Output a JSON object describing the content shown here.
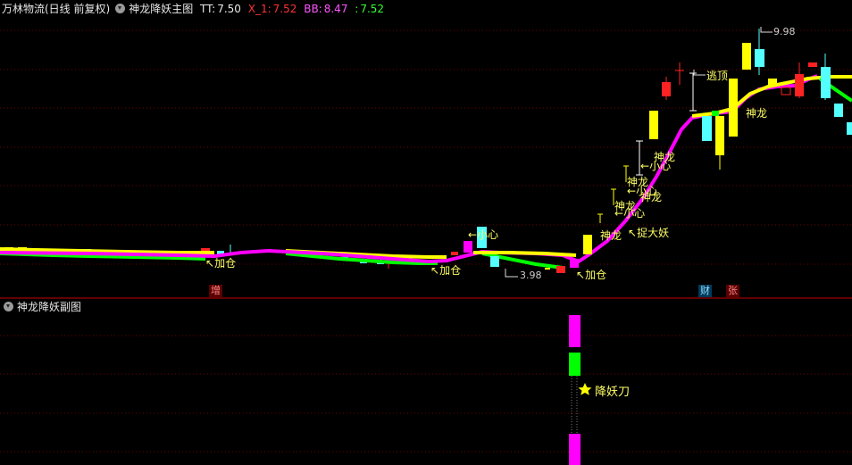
{
  "main_header": {
    "stock": "万林物流(日线 前复权)",
    "indicator": "神龙降妖主图",
    "tt_label": "TT:",
    "tt_value": "7.50",
    "x1_label": "X_1:",
    "x1_value": "7.52",
    "bb_label": "BB:",
    "bb_value": "8.47",
    "colon": ":",
    "last_value": "7.52"
  },
  "sub_header": {
    "indicator": "神龙降妖副图"
  },
  "badges": {
    "zeng": "增",
    "cai": "财",
    "zhang": "张"
  },
  "annotations": {
    "jiacang": "加仓",
    "xiaoxin": "小心",
    "shenlong": "神龙",
    "zhuodayao": "捉大妖",
    "taoding": "逃顶",
    "low_price": "3.98",
    "high_price": "9.98",
    "xiangyaodao": "降妖刀"
  },
  "icons": [
    "collapse-circle-icon",
    "star-icon",
    "arrow-icon"
  ],
  "colors": {
    "background": "#000000",
    "grid": "#6e0000",
    "up_candle": "#ff2222",
    "down_candle": "#54ffff",
    "yellow": "#ffff00",
    "magenta": "#ff00ff",
    "green": "#00ff00",
    "label_text": "#ffff66"
  }
}
